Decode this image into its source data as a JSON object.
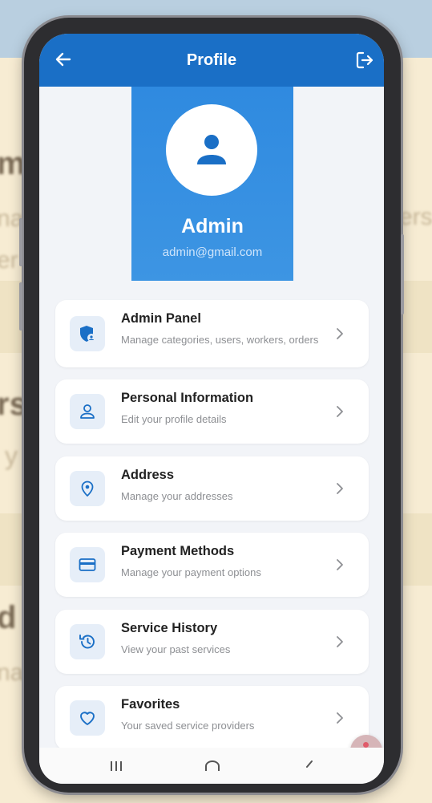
{
  "app": {
    "title": "Profile"
  },
  "user": {
    "name": "Admin",
    "email": "admin@gmail.com"
  },
  "menu": [
    {
      "title": "Admin Panel",
      "subtitle": "Manage categories, users, workers, orders",
      "icon": "admin-shield-icon"
    },
    {
      "title": "Personal Information",
      "subtitle": "Edit your profile details",
      "icon": "person-icon"
    },
    {
      "title": "Address",
      "subtitle": "Manage your addresses",
      "icon": "location-pin-icon"
    },
    {
      "title": "Payment Methods",
      "subtitle": "Manage your payment options",
      "icon": "credit-card-icon"
    },
    {
      "title": "Service History",
      "subtitle": "View your past services",
      "icon": "history-icon"
    },
    {
      "title": "Favorites",
      "subtitle": "Your saved service providers",
      "icon": "heart-icon"
    }
  ],
  "background": {
    "fragments": [
      "m",
      "na",
      "ers",
      "er",
      "rs",
      "y",
      "d",
      "na"
    ]
  },
  "colors": {
    "primary": "#1a6fc6",
    "hero": "#2f8ae0",
    "icon_bg": "#e6eef8",
    "page_bg": "#f2f4f8"
  }
}
